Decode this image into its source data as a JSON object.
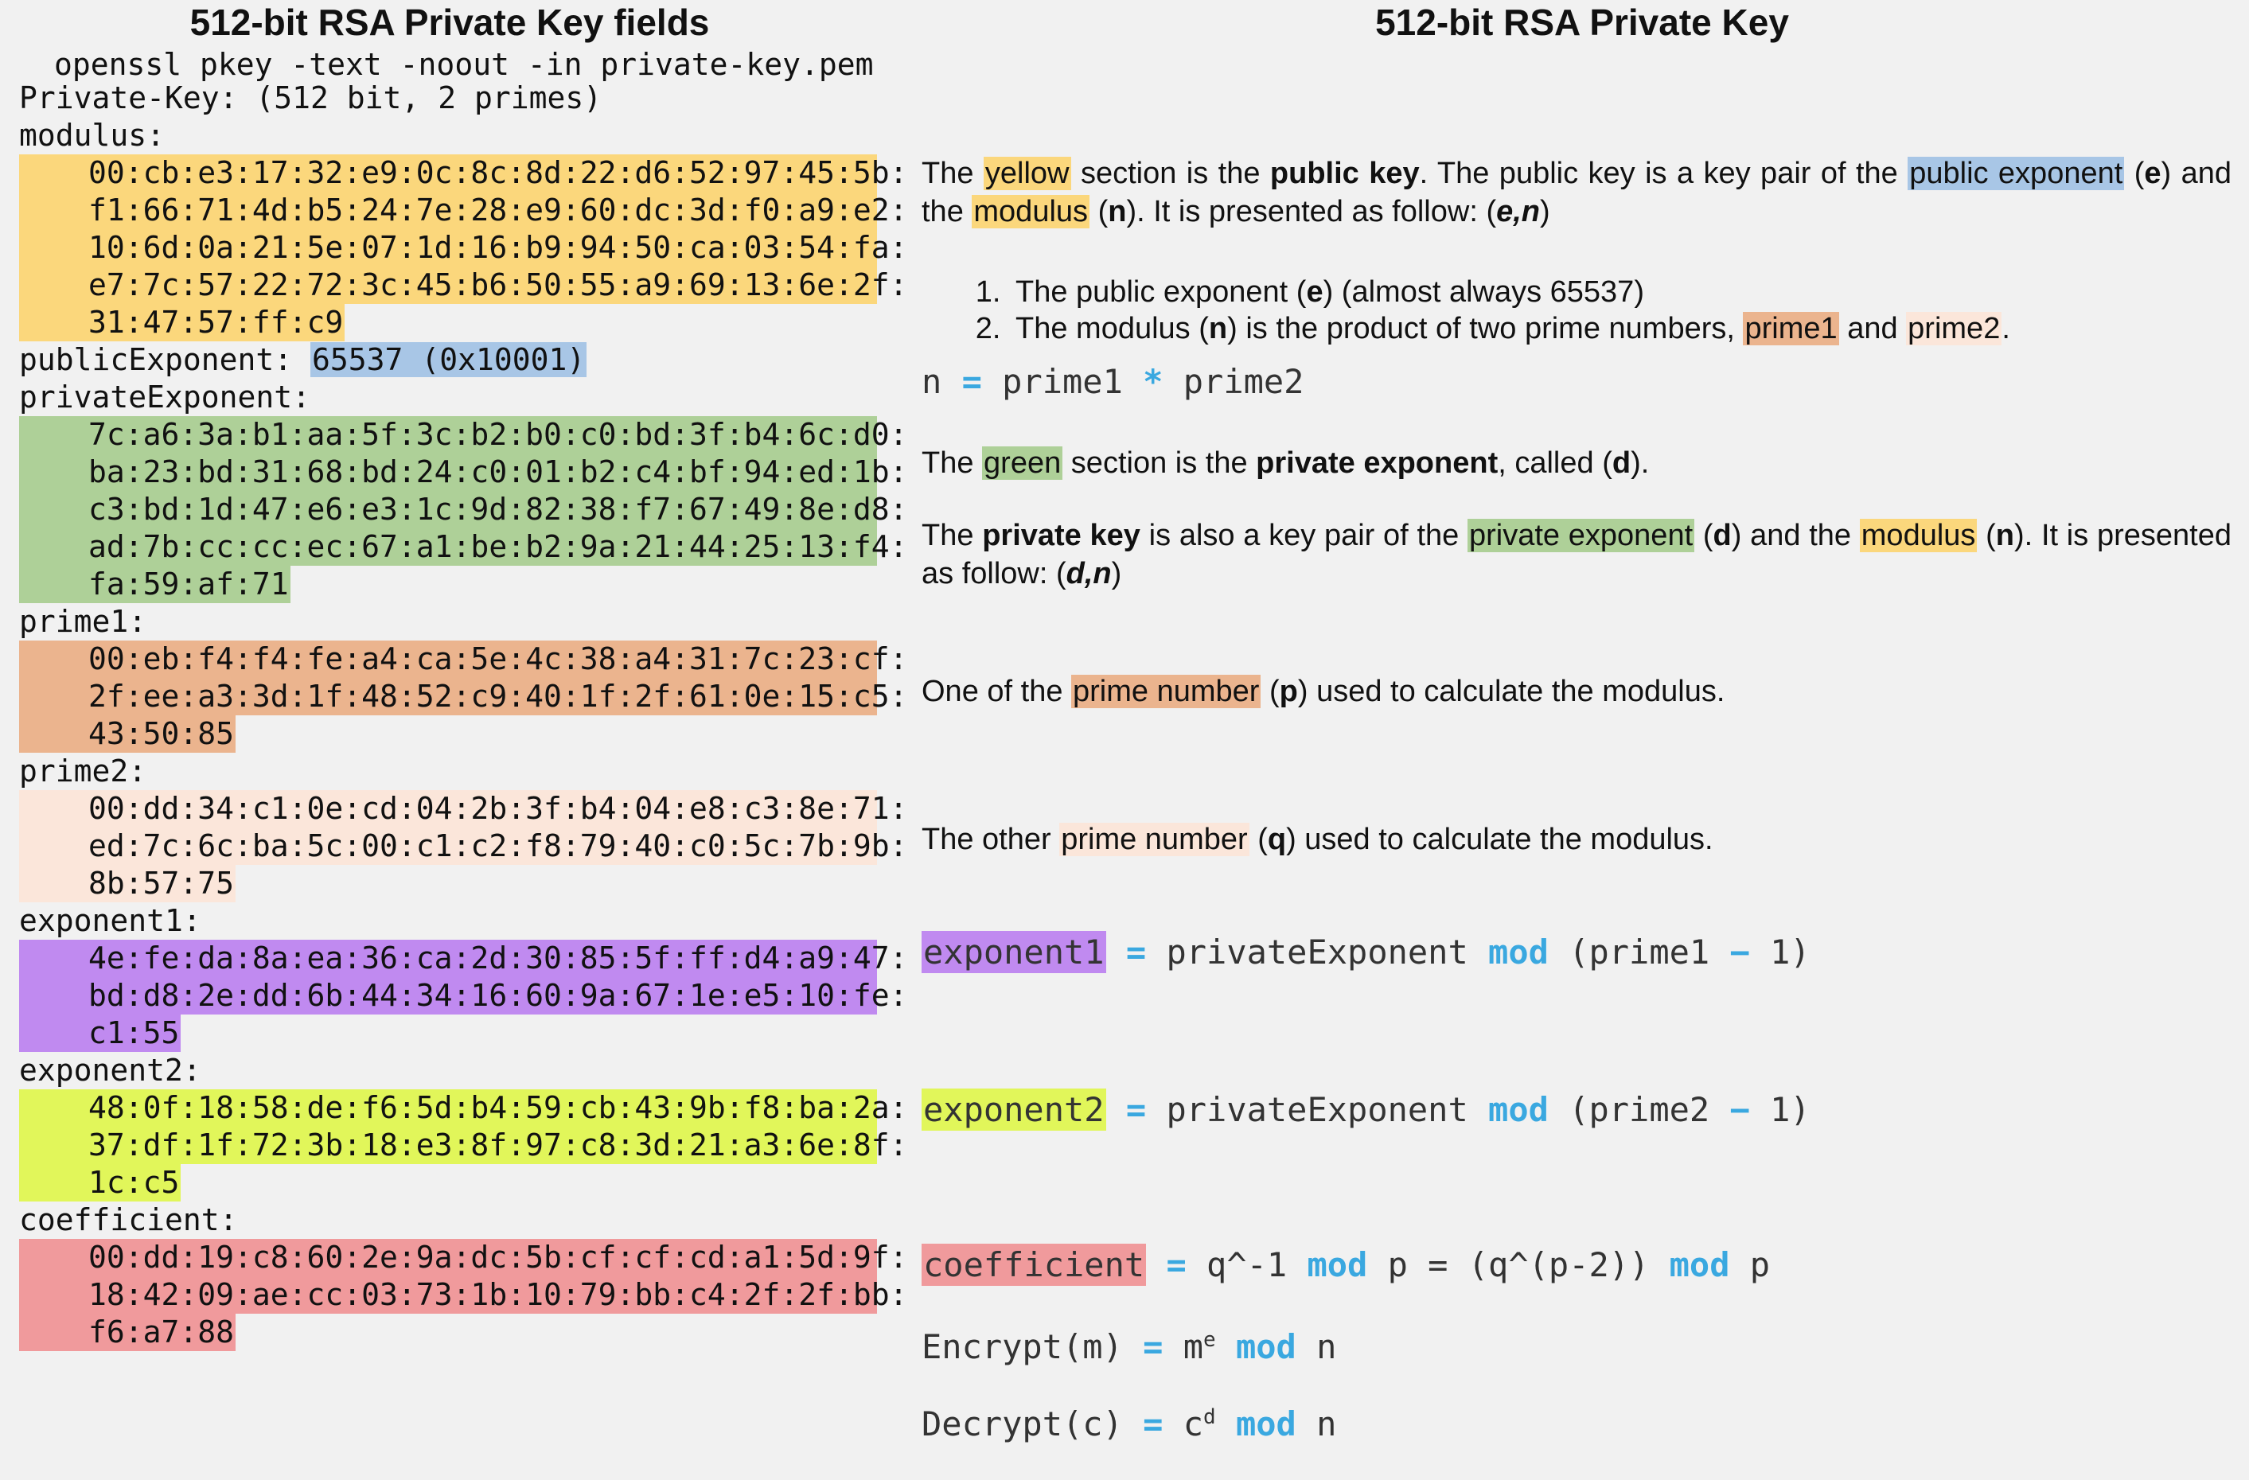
{
  "titles": {
    "left": "512-bit RSA Private Key fields",
    "right": "512-bit RSA Private Key"
  },
  "colors": {
    "modulus": "#fbd77c",
    "publicExponent": "#a8c6e6",
    "privateExponent": "#aed098",
    "prime1": "#ebb48e",
    "prime2": "#fbe6da",
    "exponent1": "#c08af0",
    "exponent2": "#e1f65a",
    "coefficient": "#f09a9c",
    "operator": "#3aa8e0"
  },
  "keydump": {
    "command": "openssl pkey -text -noout -in private-key.pem",
    "header": "Private-Key: (512 bit, 2 primes)",
    "modulus_label": "modulus:",
    "modulus": [
      "00:cb:e3:17:32:e9:0c:8c:8d:22:d6:52:97:45:5b:",
      "f1:66:71:4d:b5:24:7e:28:e9:60:dc:3d:f0:a9:e2:",
      "10:6d:0a:21:5e:07:1d:16:b9:94:50:ca:03:54:fa:",
      "e7:7c:57:22:72:3c:45:b6:50:55:a9:69:13:6e:2f:",
      "31:47:57:ff:c9"
    ],
    "publicExponent_label": "publicExponent: ",
    "publicExponent": "65537 (0x10001)",
    "privateExponent_label": "privateExponent:",
    "privateExponent": [
      "7c:a6:3a:b1:aa:5f:3c:b2:b0:c0:bd:3f:b4:6c:d0:",
      "ba:23:bd:31:68:bd:24:c0:01:b2:c4:bf:94:ed:1b:",
      "c3:bd:1d:47:e6:e3:1c:9d:82:38:f7:67:49:8e:d8:",
      "ad:7b:cc:cc:ec:67:a1:be:b2:9a:21:44:25:13:f4:",
      "fa:59:af:71"
    ],
    "prime1_label": "prime1:",
    "prime1": [
      "00:eb:f4:f4:fe:a4:ca:5e:4c:38:a4:31:7c:23:cf:",
      "2f:ee:a3:3d:1f:48:52:c9:40:1f:2f:61:0e:15:c5:",
      "43:50:85"
    ],
    "prime2_label": "prime2:",
    "prime2": [
      "00:dd:34:c1:0e:cd:04:2b:3f:b4:04:e8:c3:8e:71:",
      "ed:7c:6c:ba:5c:00:c1:c2:f8:79:40:c0:5c:7b:9b:",
      "8b:57:75"
    ],
    "exponent1_label": "exponent1:",
    "exponent1": [
      "4e:fe:da:8a:ea:36:ca:2d:30:85:5f:ff:d4:a9:47:",
      "bd:d8:2e:dd:6b:44:34:16:60:9a:67:1e:e5:10:fe:",
      "c1:55"
    ],
    "exponent2_label": "exponent2:",
    "exponent2": [
      "48:0f:18:58:de:f6:5d:b4:59:cb:43:9b:f8:ba:2a:",
      "37:df:1f:72:3b:18:e3:8f:97:c8:3d:21:a3:6e:8f:",
      "1c:c5"
    ],
    "coefficient_label": "coefficient:",
    "coefficient": [
      "00:dd:19:c8:60:2e:9a:dc:5b:cf:cf:cd:a1:5d:9f:",
      "18:42:09:ae:cc:03:73:1b:10:79:bb:c4:2f:2f:bb:",
      "f6:a7:88"
    ]
  },
  "explain": {
    "p1": {
      "t1": "The ",
      "yellow": "yellow",
      "t2": " section is the ",
      "public_key": "public key",
      "t3": ". The public key is a key pair of the ",
      "public_exponent": "public exponent",
      "t4": " (",
      "e": "e",
      "t5": ") and the ",
      "modulus": "modulus",
      "t6": " (",
      "n": "n",
      "t7": "). It is presented as follow: (",
      "en": "e,n",
      "t8": ")"
    },
    "list": [
      {
        "a": "The public exponent (",
        "b": "e",
        "c": ") (almost always 65537)"
      },
      {
        "a": "The modulus (",
        "b": "n",
        "c": ") is the product of two prime numbers, ",
        "p1": "prime1",
        "d": " and ",
        "p2": "prime2",
        "e": "."
      }
    ],
    "formula_n": {
      "lhs": "n ",
      "eq": "=",
      "a": " prime1 ",
      "mul": "*",
      "b": " prime2"
    },
    "p2": {
      "t1": "The ",
      "green": "green",
      "t2": " section is the ",
      "private_exponent": "private exponent",
      "t3": ", called (",
      "d": "d",
      "t4": ")."
    },
    "p3": {
      "t1": "The ",
      "private_key": "private key",
      "t2": " is also a key pair of the ",
      "private_exponent": "private exponent",
      "t3": " (",
      "d": "d",
      "t4": ") and the ",
      "modulus": "modulus",
      "t5": " (",
      "n": "n",
      "t6": "). It is presented as follow: (",
      "dn": "d,n",
      "t7": ")"
    },
    "p4": {
      "t1": "One of the ",
      "prime_number": "prime number",
      "t2": " (",
      "p": "p",
      "t3": ") used to calculate the modulus."
    },
    "p5": {
      "t1": "The other ",
      "prime_number": "prime number",
      "t2": " (",
      "q": "q",
      "t3": ") used to calculate the modulus."
    },
    "formula_exp1": {
      "term": "exponent1",
      "eq": "=",
      "a": " privateExponent ",
      "mod": "mod",
      "b": " (prime1 ",
      "minus": "−",
      "c": " 1)"
    },
    "formula_exp2": {
      "term": "exponent2",
      "eq": "=",
      "a": " privateExponent ",
      "mod": "mod",
      "b": " (prime2 ",
      "minus": "−",
      "c": " 1)"
    },
    "formula_coef": {
      "term": "coefficient",
      "eq": "=",
      "a": " q^-1 ",
      "mod1": "mod",
      "b": " p = (q^(p-2)) ",
      "mod2": "mod",
      "c": " p"
    },
    "formula_enc": {
      "lhs": "Encrypt(m) ",
      "eq": "=",
      "a": " m",
      "sup": "e",
      "b": " ",
      "mod": "mod",
      "c": " n"
    },
    "formula_dec": {
      "lhs": "Decrypt(c) ",
      "eq": "=",
      "a": " c",
      "sup": "d",
      "b": " ",
      "mod": "mod",
      "c": " n"
    }
  }
}
